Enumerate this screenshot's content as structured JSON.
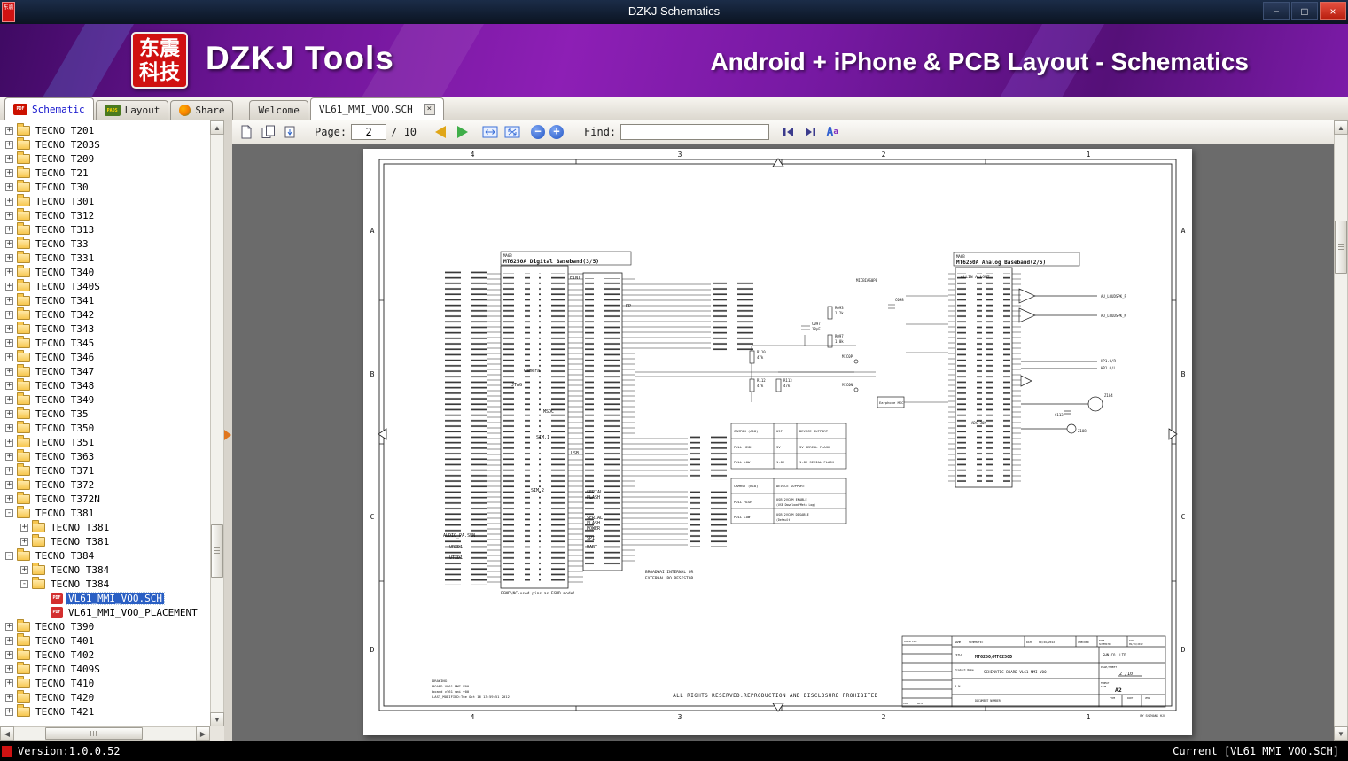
{
  "window": {
    "title": "DZKJ Schematics",
    "minimize": "−",
    "maximize": "□",
    "close": "×"
  },
  "banner": {
    "logo_top": "东震",
    "logo_bottom": "科技",
    "app_name": "DZKJ Tools",
    "tagline": "Android + iPhone & PCB Layout - Schematics"
  },
  "tabs": {
    "schematic": "Schematic",
    "layout": "Layout",
    "share": "Share",
    "pdf_badge": "PDF",
    "pads_badge": "PADS",
    "welcome": "Welcome",
    "doc": "VL61_MMI_VOO.SCH",
    "close": "×"
  },
  "toolbar": {
    "page_label": "Page:",
    "page_value": "2",
    "page_total": "/ 10",
    "find_label": "Find:",
    "find_value": ""
  },
  "sidebar": {
    "items": [
      {
        "label": "TECNO T201",
        "depth": 0,
        "type": "folder",
        "expander": "plus"
      },
      {
        "label": "TECNO T203S",
        "depth": 0,
        "type": "folder",
        "expander": "plus"
      },
      {
        "label": "TECNO T209",
        "depth": 0,
        "type": "folder",
        "expander": "plus"
      },
      {
        "label": "TECNO T21",
        "depth": 0,
        "type": "folder",
        "expander": "plus"
      },
      {
        "label": "TECNO T30",
        "depth": 0,
        "type": "folder",
        "expander": "plus"
      },
      {
        "label": "TECNO T301",
        "depth": 0,
        "type": "folder",
        "expander": "plus"
      },
      {
        "label": "TECNO T312",
        "depth": 0,
        "type": "folder",
        "expander": "plus"
      },
      {
        "label": "TECNO T313",
        "depth": 0,
        "type": "folder",
        "expander": "plus"
      },
      {
        "label": "TECNO T33",
        "depth": 0,
        "type": "folder",
        "expander": "plus"
      },
      {
        "label": "TECNO T331",
        "depth": 0,
        "type": "folder",
        "expander": "plus"
      },
      {
        "label": "TECNO T340",
        "depth": 0,
        "type": "folder",
        "expander": "plus"
      },
      {
        "label": "TECNO T340S",
        "depth": 0,
        "type": "folder",
        "expander": "plus"
      },
      {
        "label": "TECNO T341",
        "depth": 0,
        "type": "folder",
        "expander": "plus"
      },
      {
        "label": "TECNO T342",
        "depth": 0,
        "type": "folder",
        "expander": "plus"
      },
      {
        "label": "TECNO T343",
        "depth": 0,
        "type": "folder",
        "expander": "plus"
      },
      {
        "label": "TECNO T345",
        "depth": 0,
        "type": "folder",
        "expander": "plus"
      },
      {
        "label": "TECNO T346",
        "depth": 0,
        "type": "folder",
        "expander": "plus"
      },
      {
        "label": "TECNO T347",
        "depth": 0,
        "type": "folder",
        "expander": "plus"
      },
      {
        "label": "TECNO T348",
        "depth": 0,
        "type": "folder",
        "expander": "plus"
      },
      {
        "label": "TECNO T349",
        "depth": 0,
        "type": "folder",
        "expander": "plus"
      },
      {
        "label": "TECNO T35",
        "depth": 0,
        "type": "folder",
        "expander": "plus"
      },
      {
        "label": "TECNO T350",
        "depth": 0,
        "type": "folder",
        "expander": "plus"
      },
      {
        "label": "TECNO T351",
        "depth": 0,
        "type": "folder",
        "expander": "plus"
      },
      {
        "label": "TECNO T363",
        "depth": 0,
        "type": "folder",
        "expander": "plus"
      },
      {
        "label": "TECNO T371",
        "depth": 0,
        "type": "folder",
        "expander": "plus"
      },
      {
        "label": "TECNO T372",
        "depth": 0,
        "type": "folder",
        "expander": "plus"
      },
      {
        "label": "TECNO T372N",
        "depth": 0,
        "type": "folder",
        "expander": "plus"
      },
      {
        "label": "TECNO T381",
        "depth": 0,
        "type": "folder",
        "expander": "minus"
      },
      {
        "label": "TECNO T381",
        "depth": 1,
        "type": "folder",
        "expander": "plus"
      },
      {
        "label": "TECNO T381",
        "depth": 1,
        "type": "folder",
        "expander": "plus"
      },
      {
        "label": "TECNO T384",
        "depth": 0,
        "type": "folder",
        "expander": "minus"
      },
      {
        "label": "TECNO T384",
        "depth": 1,
        "type": "folder",
        "expander": "plus"
      },
      {
        "label": "TECNO T384",
        "depth": 1,
        "type": "folder",
        "expander": "minus"
      },
      {
        "label": "VL61_MMI_VOO.SCH",
        "depth": 2,
        "type": "pdf",
        "selected": true
      },
      {
        "label": "VL61_MMI_VOO_PLACEMENT",
        "depth": 2,
        "type": "pdf"
      },
      {
        "label": "TECNO T390",
        "depth": 0,
        "type": "folder",
        "expander": "plus"
      },
      {
        "label": "TECNO T401",
        "depth": 0,
        "type": "folder",
        "expander": "plus"
      },
      {
        "label": "TECNO T402",
        "depth": 0,
        "type": "folder",
        "expander": "plus"
      },
      {
        "label": "TECNO T409S",
        "depth": 0,
        "type": "folder",
        "expander": "plus"
      },
      {
        "label": "TECNO T410",
        "depth": 0,
        "type": "folder",
        "expander": "plus"
      },
      {
        "label": "TECNO T420",
        "depth": 0,
        "type": "folder",
        "expander": "plus"
      },
      {
        "label": "TECNO T421",
        "depth": 0,
        "type": "folder",
        "expander": "plus"
      }
    ]
  },
  "statusbar": {
    "version": "Version:1.0.0.52",
    "current": "Current [VL61_MMI_VOO.SCH]"
  },
  "schematic": {
    "frame": {
      "cols": [
        "4",
        "3",
        "2",
        "1"
      ],
      "rows": [
        "A",
        "B",
        "C",
        "D"
      ]
    },
    "digital": {
      "ref": "MA6B",
      "title": "MT6250A  Digital Baseband(3/5)",
      "labels": {
        "eint": "EINT",
        "kp": "KP",
        "jtag": "JTAG",
        "camera": "Camera",
        "msdc": "MSDC",
        "sim1": "SIM.1",
        "usb": "USB",
        "sim2": "SIM.2",
        "sf1": "SERIAL",
        "sf2": "FLASH",
        "sfp1": "SERIAL",
        "sfp2": "FLASH",
        "sfp3": "POWER",
        "spi": "SPI",
        "uart": "UART",
        "audio": "AUDIO_PA.SEN",
        "urxd": "URXD1",
        "utxd": "UTXD1",
        "egnd": "EGND\\NC-used pins as EGND mode!"
      }
    },
    "analog": {
      "ref": "MA6B",
      "title": "MT6250A  Analog Baseband(2/5)",
      "allin": "ALLIN ALLOUT",
      "labels": {
        "micbias": "MICBIAS0P8",
        "earmic": "Earphone MIC",
        "adc": "ADC 30K",
        "loudspk_p": "AU_LOUDSPK_P",
        "loudspk_n": "AU_LOUDSPK_N",
        "hp_r": "HP1.0/R",
        "hp_l": "HP1.0/L",
        "z104": "Z104",
        "z108": "Z108",
        "c113": "C113"
      }
    },
    "components": {
      "r110": "R110",
      "r110v": "47k",
      "r112": "R112",
      "r112v": "47k",
      "r113": "R113",
      "r113v": "47k",
      "c097": "C097",
      "c097v": "18pF",
      "r093": "R093",
      "r093v": "1.2k",
      "r097": "R097",
      "r097v": "1.0k",
      "c098": "C098",
      "mic0p": "MIC0P",
      "mic0n": "MIC0N"
    },
    "note1": "BROADWAI INTERNAL OR",
    "note2": "EXTERNAL PO RESISTOR",
    "tables": {
      "campon": {
        "header": [
          "CAMPON (A18)",
          "U9F",
          "DEVICE SUPPORT"
        ],
        "rows": [
          [
            "PULL HIGH",
            "3V",
            "3V SERIAL FLASH"
          ],
          [
            "PULL LOW",
            "1.8V",
            "1.8V SERIAL FLASH"
          ]
        ]
      },
      "camrst": {
        "header": [
          "CAMRST (B18)",
          "DEVICE SUPPORT"
        ],
        "rows": [
          [
            "PULL HIGH",
            "USB 2VCOM ENABLE",
            "(USB Download/Meta Log)"
          ],
          [
            "PULL LOW",
            "USB 2VCOM DISABLE",
            "(Default)"
          ]
        ]
      }
    },
    "title_block": {
      "modified": "MODIFIED",
      "name_label": "NAME",
      "name1": "SCHEMATIC",
      "date_label": "DATE",
      "date1": "09/26/2012",
      "checked": "CHECKED",
      "name2_label": "NAME",
      "name2": "SCHEMATIC",
      "date2_label": "DATE",
      "date2": "09/26/2012",
      "title_label": "TITLE",
      "title": "MT6250/MT6250D",
      "product_label": "Product Name",
      "product": "SCHEMATIC BOARD VL61 MMI V00",
      "company": "SHN CO. LTD.",
      "page_label": "PAGE/SHEET",
      "page": "2 /10",
      "pn_label": "P.N.",
      "format_label": "FORMAT",
      "size_label": "SIZE",
      "format": "A2",
      "doc_label": "DOCUMENT NUMBER",
      "type_label": "TYPE",
      "part_label": "PART",
      "vers_label": "VERS",
      "ver_label": "VER",
      "date3_label": "DATE",
      "by": "BY SHZHANG HJG"
    },
    "drawing": {
      "l1": "DRAWING:",
      "l2": "BOARD VL61 MMI V00",
      "l3": "board vl61 mmi v00",
      "l4": "LAST_MODIFIED:Tue Oct 16 13:59:51 2012"
    },
    "footer": "ALL RIGHTS RESERVED.REPRODUCTION AND DISCLOSURE PROHIBITED"
  }
}
